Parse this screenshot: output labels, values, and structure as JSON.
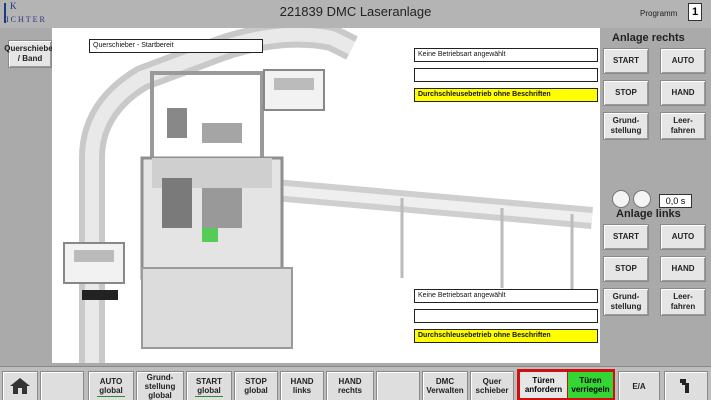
{
  "header": {
    "logo_k": "K",
    "logo_text": "ICHTER",
    "title": "221839 DMC Laseranlage",
    "program_label": "Programm",
    "program_number": "1"
  },
  "left_panel": {
    "mode_button": "Querschieber / Band"
  },
  "status": {
    "querschieber": "Querschieber - Startbereit"
  },
  "right": {
    "section": "Anlage rechts",
    "mode_text": "Keine Betriebsart angewählt",
    "message": "",
    "mode_yellow": "Durchschleusebetrieb ohne Beschriften",
    "start": "START",
    "auto": "AUTO",
    "stop": "STOP",
    "hand": "HAND",
    "home": "Grund-\nstellung",
    "empty": "Leer-\nfahren"
  },
  "left": {
    "section": "Anlage links",
    "time": "0,0 s",
    "mode_text": "Keine Betriebsart angewählt",
    "message": "",
    "mode_yellow": "Durchschleusebetrieb ohne Beschriften",
    "start": "START",
    "auto": "AUTO",
    "stop": "STOP",
    "hand": "HAND",
    "home": "Grund-\nstellung",
    "empty": "Leer-\nfahren"
  },
  "footer": {
    "auto_global": "AUTO\nglobal",
    "home_global": "Grund-\nstellung\nglobal",
    "start_global": "START\nglobal",
    "stop_global": "STOP\nglobal",
    "hand_left": "HAND\nlinks",
    "hand_right": "HAND\nrechts",
    "dmc_manage": "DMC\nVerwalten",
    "cross_slider": "Quer\nschieber",
    "doors_request": "Türen\nanfordern",
    "doors_lock": "Türen\nverriegeln",
    "io": "E/A"
  },
  "colors": {
    "accent_green": "#33d633",
    "alert_red": "#d01010",
    "yellow": "#ffff00"
  }
}
